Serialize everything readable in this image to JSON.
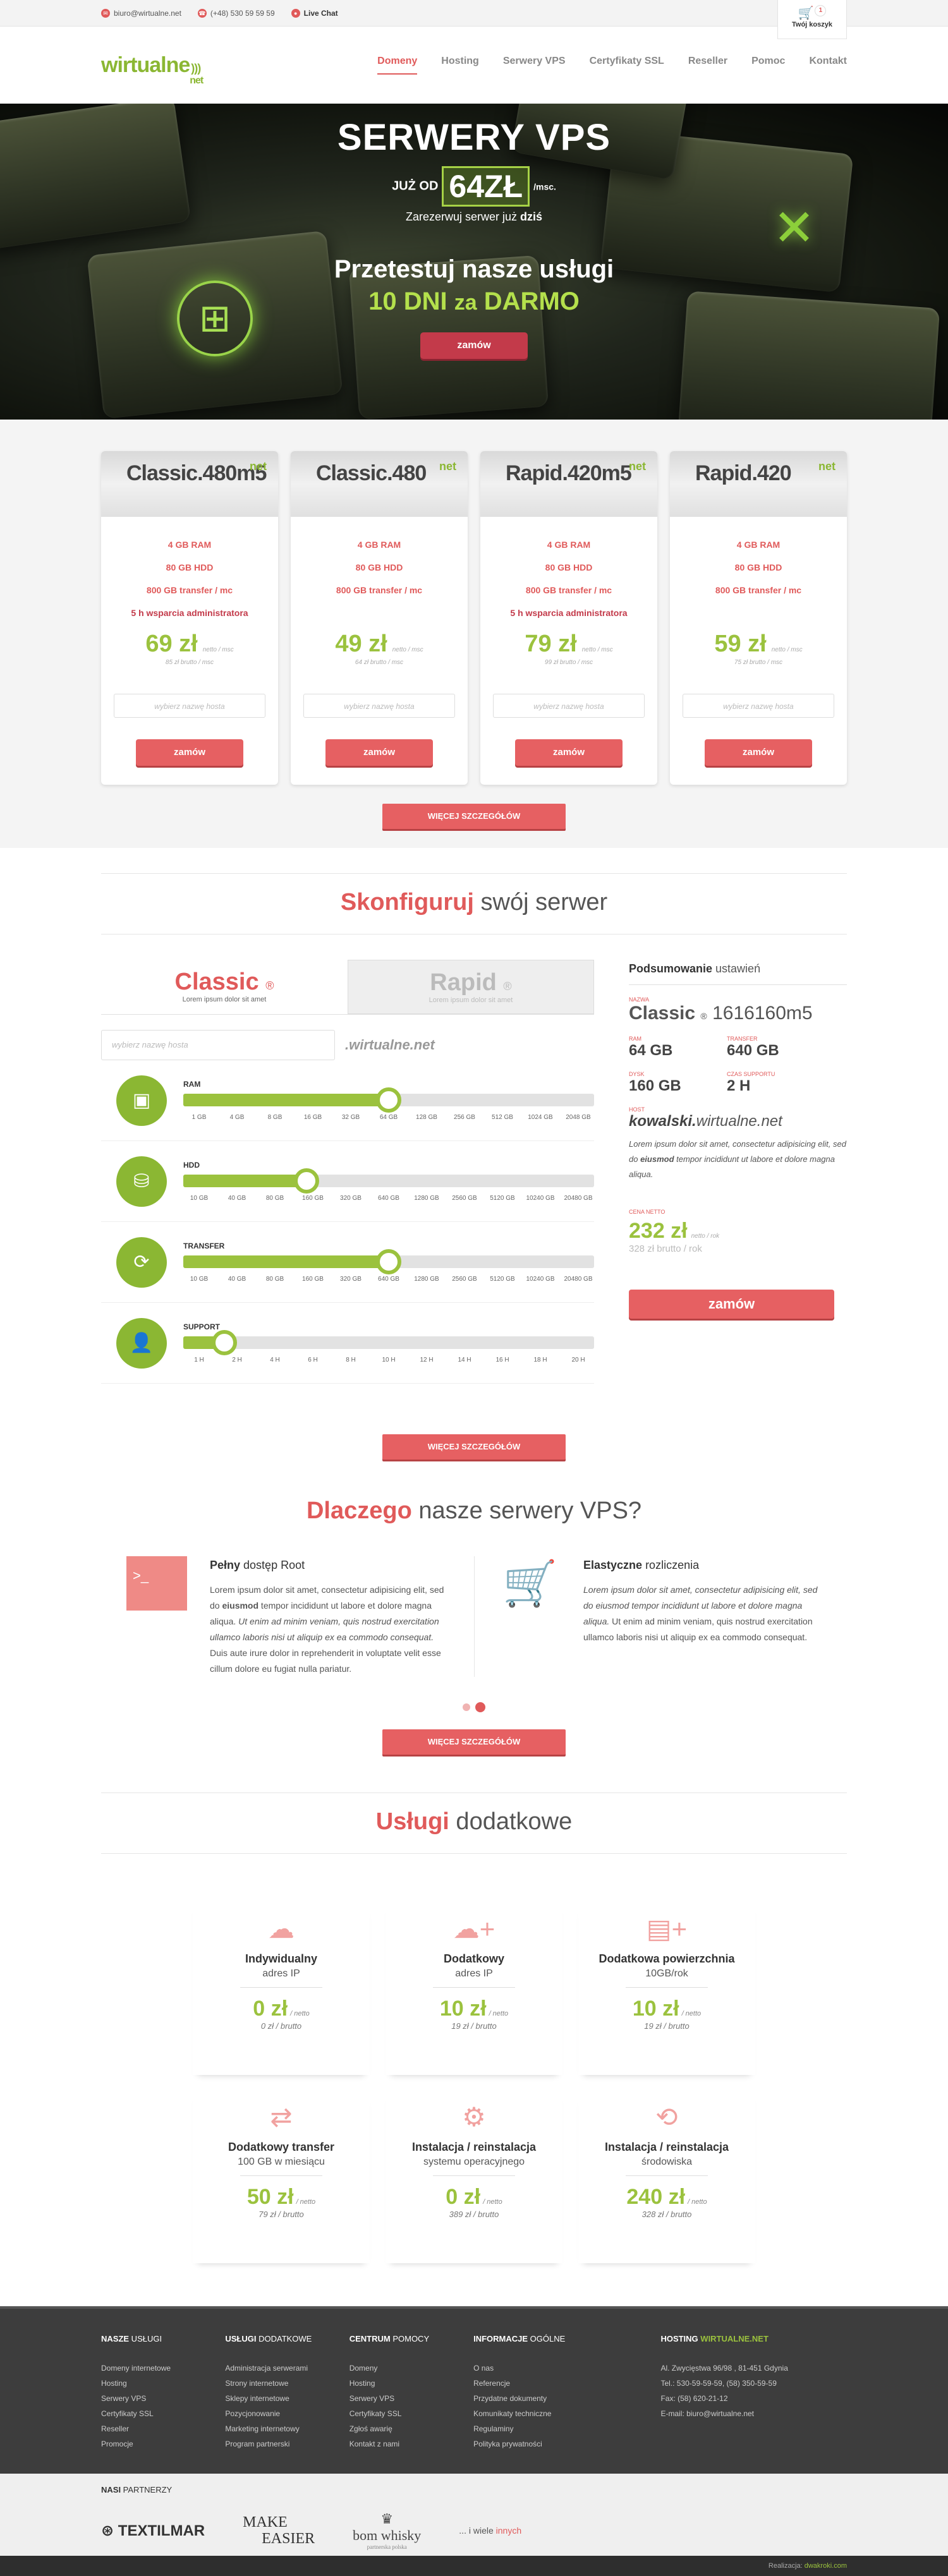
{
  "topbar": {
    "email": "biuro@wirtualne.net",
    "phone": "(+48) 530 59 59 59",
    "chat": "Live Chat",
    "cart_label": "Twój koszyk",
    "cart_count": "1"
  },
  "header": {
    "logo_main": "wirtualne",
    "logo_sub": "net",
    "nav": [
      "Domeny",
      "Hosting",
      "Serwery VPS",
      "Certyfikaty SSL",
      "Reseller",
      "Pomoc",
      "Kontakt"
    ]
  },
  "hero": {
    "title": "SERWERY VPS",
    "from": "JUŻ OD",
    "price": "64ZŁ",
    "unit": "/msc.",
    "reserve_pre": "Zarezerwuj serwer już ",
    "reserve_bold": "dziś",
    "try": "Przetestuj nasze usługi",
    "free_a": "10 DNI",
    "free_b": "za",
    "free_c": "DARMO",
    "button": "zamów"
  },
  "plans": [
    {
      "name": "Classic.480m5",
      "logo": "net",
      "ram": "4 GB RAM",
      "hdd": "80 GB HDD",
      "transfer": "800 GB transfer / mc",
      "support": "5 h wsparcia administratora",
      "price": "69 zł",
      "net": "netto / msc",
      "gross": "85 zł brutto / msc",
      "input": "wybierz nazwę hosta",
      "button": "zamów"
    },
    {
      "name": "Classic.480",
      "logo": "net",
      "ram": "4 GB RAM",
      "hdd": "80 GB HDD",
      "transfer": "800 GB transfer / mc",
      "support": "",
      "price": "49 zł",
      "net": "netto / msc",
      "gross": "64 zł brutto / msc",
      "input": "wybierz nazwę hosta",
      "button": "zamów"
    },
    {
      "name": "Rapid.420m5",
      "logo": "net",
      "ram": "4 GB RAM",
      "hdd": "80 GB HDD",
      "transfer": "800 GB transfer / mc",
      "support": "5 h wsparcia administratora",
      "price": "79 zł",
      "net": "netto / msc",
      "gross": "99 zł brutto / msc",
      "input": "wybierz nazwę hosta",
      "button": "zamów"
    },
    {
      "name": "Rapid.420",
      "logo": "net",
      "ram": "4 GB RAM",
      "hdd": "80 GB HDD",
      "transfer": "800 GB transfer / mc",
      "support": "",
      "price": "59 zł",
      "net": "netto / msc",
      "gross": "75 zł brutto / msc",
      "input": "wybierz nazwę hosta",
      "button": "zamów"
    }
  ],
  "more_button": "WIĘCEJ SZCZEGÓŁÓW",
  "config": {
    "title_hl": "Skonfiguruj",
    "title_rest": " swój serwer",
    "tabs": [
      {
        "name": "Classic",
        "mark": "®",
        "sub": "Lorem ipsum dolor sit amet"
      },
      {
        "name": "Rapid",
        "mark": "®",
        "sub": "Lorem ipsum dolor sit amet"
      }
    ],
    "host_placeholder": "wybierz nazwę hosta",
    "host_domain": ".wirtualne.net",
    "sliders": [
      {
        "label": "RAM",
        "icon": "memory-icon",
        "level": 0.5,
        "ticks": [
          "1 GB",
          "4 GB",
          "8 GB",
          "16 GB",
          "32 GB",
          "64 GB",
          "128 GB",
          "256 GB",
          "512 GB",
          "1024 GB",
          "2048 GB"
        ]
      },
      {
        "label": "HDD",
        "icon": "hdd-icon",
        "level": 0.3,
        "ticks": [
          "10 GB",
          "40 GB",
          "80 GB",
          "160 GB",
          "320 GB",
          "640 GB",
          "1280 GB",
          "2560 GB",
          "5120 GB",
          "10240 GB",
          "20480 GB"
        ]
      },
      {
        "label": "TRANSFER",
        "icon": "refresh-icon",
        "level": 0.5,
        "ticks": [
          "10 GB",
          "40 GB",
          "80 GB",
          "160 GB",
          "320 GB",
          "640 GB",
          "1280 GB",
          "2560 GB",
          "5120 GB",
          "10240 GB",
          "20480 GB"
        ]
      },
      {
        "label": "SUPPORT",
        "icon": "user-icon",
        "level": 0.1,
        "ticks": [
          "1 H",
          "2 H",
          "4 H",
          "6 H",
          "8 H",
          "10 H",
          "12 H",
          "14 H",
          "16 H",
          "18 H",
          "20 H"
        ]
      }
    ],
    "summary": {
      "title_b": "Podsumowanie",
      "title_rest": " ustawień",
      "name_label": "NAZWA",
      "name": "Classic",
      "mark": "®",
      "code": "1616160m5",
      "ram_label": "RAM",
      "ram": "64 GB",
      "transfer_label": "TRANSFER",
      "transfer": "640 GB",
      "disk_label": "DYSK",
      "disk": "160 GB",
      "support_label": "CZAS SUPPORTU",
      "support": "2 H",
      "host_label": "HOST",
      "host_b": "kowalski.",
      "host_rest": "wirtualne.net",
      "desc_pre": "Lorem ipsum dolor sit amet, consectetur adipisicing elit, sed do ",
      "desc_bold": "eiusmod",
      "desc_post": " tempor incididunt ut labore et dolore magna aliqua.",
      "price_label": "CENA NETTO",
      "price": "232 zł",
      "price_net": "netto / rok",
      "gross": "328 zł  brutto / rok",
      "button": "zamów"
    }
  },
  "why": {
    "title_hl": "Dlaczego",
    "title_rest": " nasze serwery VPS?",
    "items": [
      {
        "icon": "terminal-icon",
        "title_b": "Pełny",
        "title_rest": " dostęp Root",
        "p1": "Lorem ipsum dolor sit amet, consectetur adipisicing elit, sed do ",
        "pb": "eiusmod",
        "p2": " tempor incididunt ut labore et dolore magna aliqua. ",
        "pi": "Ut enim ad minim veniam, quis nostrud exercitation ullamco laboris nisi ut aliquip ex ea commodo consequat.",
        "p3": " Duis aute irure dolor in reprehenderit in voluptate velit esse cillum dolore eu fugiat nulla pariatur."
      },
      {
        "icon": "cart-check-icon",
        "title_b": "Elastyczne",
        "title_rest": " rozliczenia",
        "p1": "",
        "pb": "",
        "p2": "",
        "pi": "Lorem ipsum dolor sit amet, consectetur adipisicing elit, sed do eiusmod tempor incididunt ut labore et dolore magna aliqua.",
        "p3": " Ut enim ad minim veniam, quis nostrud exercitation ullamco laboris nisi ut aliquip ex ea commodo consequat."
      }
    ]
  },
  "extra": {
    "title_hl": "Usługi",
    "title_rest": " dodatkowe",
    "items": [
      {
        "icon": "cloud-icon",
        "name": "Indywidualny",
        "desc": "adres IP",
        "price": "0 zł",
        "net": "/ netto",
        "gross": "0 zł / brutto"
      },
      {
        "icon": "cloud-plus-icon",
        "name": "Dodatkowy",
        "desc": "adres IP",
        "price": "10 zł",
        "net": "/ netto",
        "gross": "19 zł / brutto"
      },
      {
        "icon": "storage-plus-icon",
        "name": "Dodatkowa powierzchnia",
        "desc": "10GB/rok",
        "price": "10 zł",
        "net": "/ netto",
        "gross": "19 zł / brutto"
      },
      {
        "icon": "transfer-icon",
        "name": "Dodatkowy transfer",
        "desc": "100 GB w miesiącu",
        "price": "50 zł",
        "net": "/ netto",
        "gross": "79 zł / brutto"
      },
      {
        "icon": "install-icon",
        "name": "Instalacja / reinstalacja",
        "desc": "systemu operacyjnego",
        "price": "0 zł",
        "net": "/ netto",
        "gross": "389 zł / brutto"
      },
      {
        "icon": "reinstall-icon",
        "name": "Instalacja / reinstalacja",
        "desc": "środowiska",
        "price": "240 zł",
        "net": "/ netto",
        "gross": "328 zł / brutto"
      }
    ]
  },
  "footer": {
    "cols": [
      {
        "t_b": "NASZE",
        "t_rest": " USŁUGI",
        "links": [
          "Domeny internetowe",
          "Hosting",
          "Serwery VPS",
          "Certyfikaty SSL",
          "Reseller",
          "Promocje"
        ]
      },
      {
        "t_b": "USŁUGI",
        "t_rest": " DODATKOWE",
        "links": [
          "Administracja serwerami",
          "Strony internetowe",
          "Sklepy internetowe",
          "Pozycjonowanie",
          "Marketing internetowy",
          "Program partnerski"
        ]
      },
      {
        "t_b": "CENTRUM",
        "t_rest": " POMOCY",
        "links": [
          "Domeny",
          "Hosting",
          "Serwery VPS",
          "Certyfikaty SSL",
          "Zgłoś awarię",
          "Kontakt z nami"
        ]
      },
      {
        "t_b": "INFORMACJE",
        "t_rest": " OGÓLNE",
        "links": [
          "O nas",
          "Referencje",
          "Przydatne dokumenty",
          "Komunikaty techniczne",
          "Regulaminy",
          "Polityka prywatności"
        ]
      }
    ],
    "contact_title": "HOSTING",
    "contact_brand": "WIRTUALNE.NET",
    "contact": [
      "Al. Zwycięstwa 96/98 , 81-451 Gdynia",
      "Tel.: 530-59-59-59, (58) 350-59-59",
      "Fax: (58) 620-21-12",
      "E-mail: biuro@wirtualne.net"
    ]
  },
  "partners": {
    "title_b": "NASI",
    "title_rest": " PARTNERZY",
    "logos": [
      "TEXTILMAR",
      "MAKE",
      "EASIER",
      "bom whisky",
      "partnerska polska"
    ],
    "more_pre": "... i wiele ",
    "more_hl": "innych"
  },
  "credits": {
    "pre": "Realizacja: ",
    "brand": "dwakroki.com"
  }
}
